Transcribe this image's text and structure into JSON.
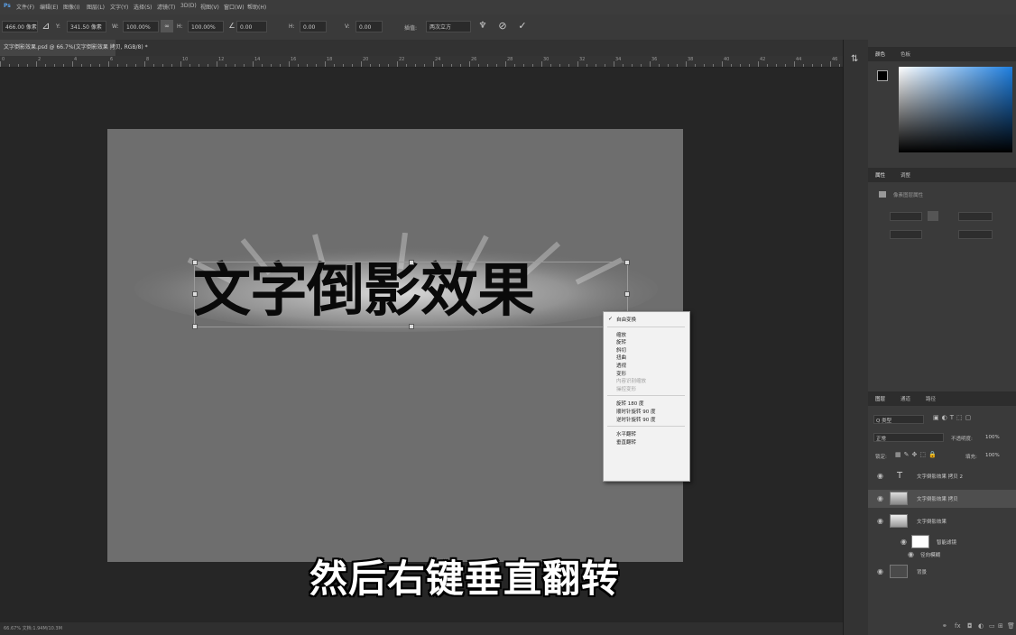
{
  "menubar": {
    "items": [
      "文件(F)",
      "编辑(E)",
      "图像(I)",
      "图层(L)",
      "文字(Y)",
      "选择(S)",
      "滤镜(T)",
      "3D(D)",
      "视图(V)",
      "窗口(W)",
      "帮助(H)"
    ]
  },
  "options": {
    "x_label": "X:",
    "x_value": "466.00 像素",
    "y_label": "Y:",
    "y_value": "341.50 像素",
    "w_label": "W:",
    "w_value": "100.00%",
    "h_label": "H:",
    "h_value": "100.00%",
    "angle_value": "0.00",
    "hskew_label": "H:",
    "hskew_value": "0.00",
    "vskew_label": "V:",
    "vskew_value": "0.00",
    "interp_label": "插值:",
    "interp_value": "两次立方"
  },
  "document": {
    "tab_title": "文字倒影效果.psd @ 66.7%(文字倒影效果 拷贝, RGB/8) *",
    "headline": "文字倒影效果",
    "ruler_numbers": [
      "0",
      "2",
      "4",
      "6",
      "8",
      "10",
      "12",
      "14",
      "16",
      "18",
      "20",
      "22",
      "24",
      "26",
      "28",
      "30",
      "32",
      "34",
      "36",
      "38",
      "40",
      "42",
      "44",
      "46"
    ]
  },
  "context_menu": {
    "items": [
      {
        "label": "自由变换",
        "disabled": false,
        "checked": true
      },
      {
        "sep": true
      },
      {
        "label": "缩放",
        "disabled": false
      },
      {
        "label": "旋转",
        "disabled": false
      },
      {
        "label": "斜切",
        "disabled": false
      },
      {
        "label": "扭曲",
        "disabled": false
      },
      {
        "label": "透视",
        "disabled": false
      },
      {
        "label": "变形",
        "disabled": false
      },
      {
        "label": "内容识别缩放",
        "disabled": true
      },
      {
        "label": "操控变形",
        "disabled": true
      },
      {
        "sep": true
      },
      {
        "label": "旋转 180 度",
        "disabled": false
      },
      {
        "label": "顺时针旋转 90 度",
        "disabled": false
      },
      {
        "label": "逆时针旋转 90 度",
        "disabled": false
      },
      {
        "sep": true
      },
      {
        "label": "水平翻转",
        "disabled": false
      },
      {
        "label": "垂直翻转",
        "disabled": false
      }
    ]
  },
  "subtitle": "然后右键垂直翻转",
  "status": {
    "zoom_info": "66.67%   文档:1.94M/10.3M"
  },
  "panels": {
    "color_tabs": [
      "颜色",
      "色板"
    ],
    "props_tabs": [
      "属性",
      "调整"
    ],
    "props_title": "像素图层属性",
    "layers_tabs": [
      "图层",
      "通道",
      "路径"
    ],
    "kind_label": "Q 类型",
    "blend_mode": "正常",
    "opacity_label": "不透明度:",
    "opacity_value": "100%",
    "lock_label": "锁定:",
    "fill_label": "填充:",
    "fill_value": "100%",
    "layers": [
      {
        "name": "文字倒影效果 拷贝 2",
        "type": "text"
      },
      {
        "name": "文字倒影效果 拷贝",
        "type": "pixel"
      },
      {
        "name": "文字倒影效果",
        "type": "pixel"
      },
      {
        "name": "智能滤镜",
        "type": "filter"
      },
      {
        "name": "径向模糊",
        "type": "filter-item"
      },
      {
        "name": "背景",
        "type": "background"
      }
    ]
  },
  "colors": {
    "fg": "#000000",
    "bg": "#ffffff",
    "accent": "#1e7fe0"
  }
}
